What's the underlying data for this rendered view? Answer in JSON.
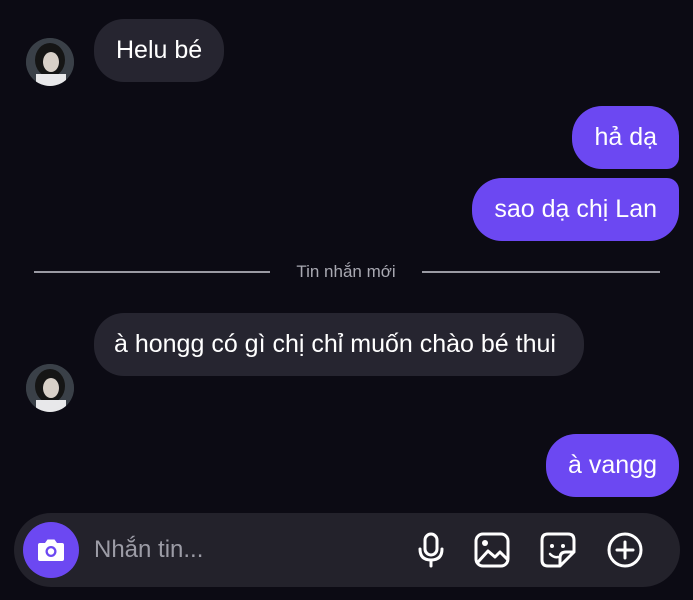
{
  "messages": [
    {
      "direction": "incoming",
      "text": "Helu bé"
    },
    {
      "direction": "outgoing",
      "text": "hả dạ"
    },
    {
      "direction": "outgoing",
      "text": "sao dạ chị Lan"
    },
    {
      "direction": "incoming",
      "text": "à hongg có gì chị chỉ muốn chào bé thui"
    },
    {
      "direction": "outgoing",
      "text": "à vangg"
    }
  ],
  "divider": {
    "label": "Tin nhắn mới"
  },
  "composer": {
    "placeholder": "Nhắn tin...",
    "icons": [
      "camera-icon",
      "microphone-icon",
      "gallery-icon",
      "sticker-icon",
      "plus-icon"
    ]
  },
  "colors": {
    "background": "#0c0b14",
    "incoming_bubble": "#262530",
    "outgoing_bubble": "#6c48f2",
    "composer": "#23222b"
  }
}
